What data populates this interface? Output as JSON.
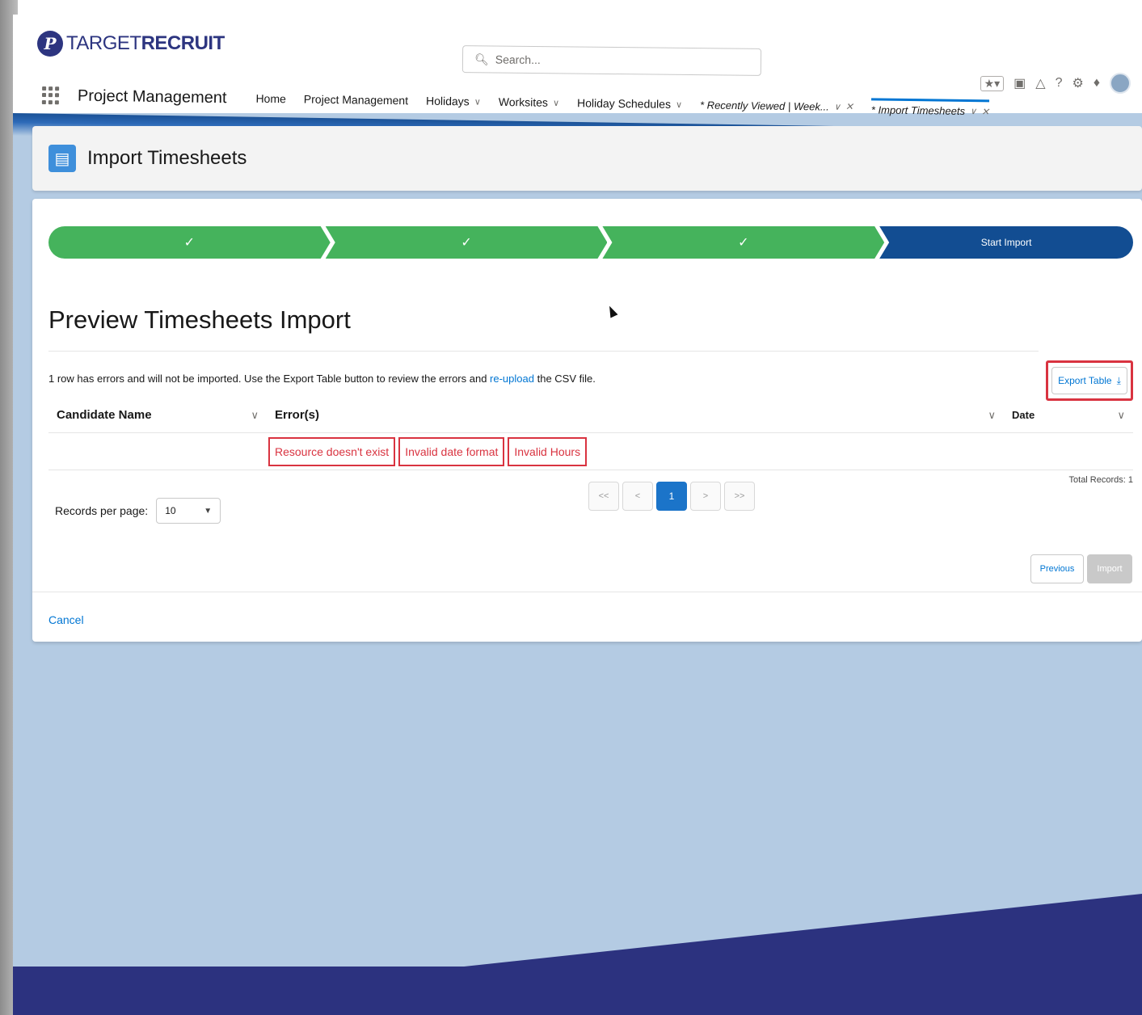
{
  "brand": {
    "logo_mark": "P",
    "logo_text_light": "TARGET",
    "logo_text_bold": "RECRUIT"
  },
  "search": {
    "placeholder": "Search..."
  },
  "utility": {
    "icons": [
      "favorites-star-icon",
      "add-icon",
      "setup-assistant-icon",
      "help-icon",
      "gear-icon",
      "bell-icon",
      "avatar"
    ]
  },
  "nav": {
    "app_name": "Project Management",
    "items": [
      {
        "label": "Home",
        "has_menu": false
      },
      {
        "label": "Project Management",
        "has_menu": false
      },
      {
        "label": "Holidays",
        "has_menu": true
      },
      {
        "label": "Worksites",
        "has_menu": true
      },
      {
        "label": "Holiday Schedules",
        "has_menu": true
      }
    ],
    "tabs": [
      {
        "label": "* Recently Viewed | Week...",
        "active": false
      },
      {
        "label": "* Import Timesheets",
        "active": true
      }
    ]
  },
  "page_header": {
    "title": "Import Timesheets"
  },
  "path": {
    "steps": [
      {
        "label": "✓",
        "state": "complete"
      },
      {
        "label": "✓",
        "state": "complete"
      },
      {
        "label": "✓",
        "state": "complete"
      },
      {
        "label": "Start Import",
        "state": "current"
      }
    ]
  },
  "preview": {
    "title": "Preview Timesheets Import",
    "message_before": "1 row has errors and will not be imported. Use the Export Table button to review the errors and ",
    "message_link": "re-upload",
    "message_after": " the CSV file.",
    "export_label": "Export Table"
  },
  "table": {
    "columns": [
      "Candidate Name",
      "Error(s)",
      "Date"
    ],
    "rows": [
      {
        "candidate_name": "",
        "errors": [
          "Resource doesn't exist",
          "Invalid date format",
          "Invalid Hours"
        ],
        "date": ""
      }
    ]
  },
  "pagination": {
    "records_per_page_label": "Records per page:",
    "records_per_page_value": "10",
    "first": "<<",
    "prev": "<",
    "current": "1",
    "next": ">",
    "last": ">>",
    "total_records": "Total Records: 1"
  },
  "actions": {
    "previous": "Previous",
    "import": "Import",
    "cancel": "Cancel"
  },
  "colors": {
    "brand": "#2d3580",
    "path_complete": "#45b35c",
    "path_current": "#124d92",
    "error": "#d93340",
    "link": "#0176d3"
  }
}
